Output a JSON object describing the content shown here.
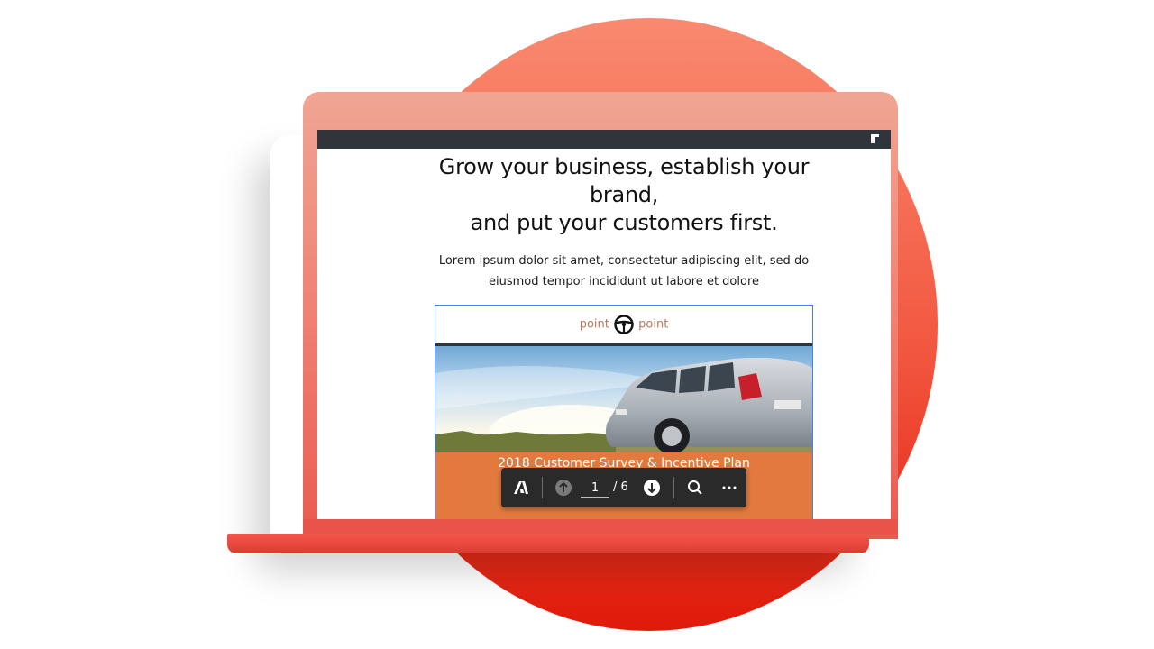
{
  "hero": {
    "title_line1": "Grow your business, establish your",
    "title_line2": "brand,",
    "title_line3": "and put your customers first.",
    "subtitle_line1": "Lorem ipsum dolor sit amet, consectetur adipiscing elit, sed do",
    "subtitle_line2": "eiusmod tempor incididunt ut labore et dolore"
  },
  "pdf": {
    "logo_left": "point",
    "logo_right": "point",
    "banner_title": "2018 Customer Survey & Incentive Plan"
  },
  "viewer_toolbar": {
    "current_page": "1",
    "total_pages": "/ 6",
    "icons": [
      "adobe-icon",
      "page-up-icon",
      "page-down-icon",
      "search-icon",
      "more-icon"
    ]
  },
  "colors": {
    "background_circle": "#f2563f",
    "laptop_body": "#ef8173",
    "banner": "#e27a3e",
    "toolbar": "#2a2a2a",
    "pdf_frame_border": "#3b82f6"
  }
}
